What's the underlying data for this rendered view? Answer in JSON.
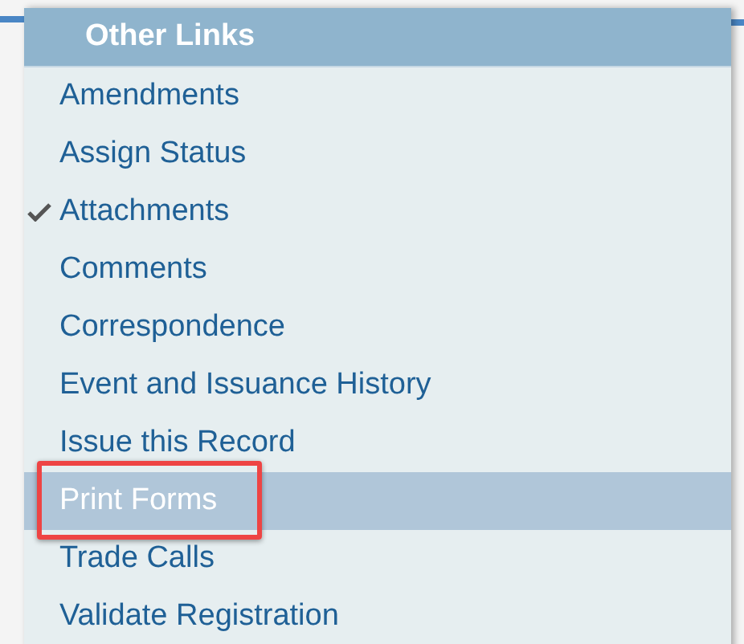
{
  "menu": {
    "title": "Other Links",
    "items": [
      {
        "label": "Amendments",
        "checked": false,
        "selected": false
      },
      {
        "label": "Assign Status",
        "checked": false,
        "selected": false
      },
      {
        "label": "Attachments",
        "checked": true,
        "selected": false
      },
      {
        "label": "Comments",
        "checked": false,
        "selected": false
      },
      {
        "label": "Correspondence",
        "checked": false,
        "selected": false
      },
      {
        "label": "Event and Issuance History",
        "checked": false,
        "selected": false
      },
      {
        "label": "Issue this Record",
        "checked": false,
        "selected": false
      },
      {
        "label": "Print Forms",
        "checked": false,
        "selected": true
      },
      {
        "label": "Trade Calls",
        "checked": false,
        "selected": false
      },
      {
        "label": "Validate Registration",
        "checked": false,
        "selected": false
      }
    ]
  }
}
